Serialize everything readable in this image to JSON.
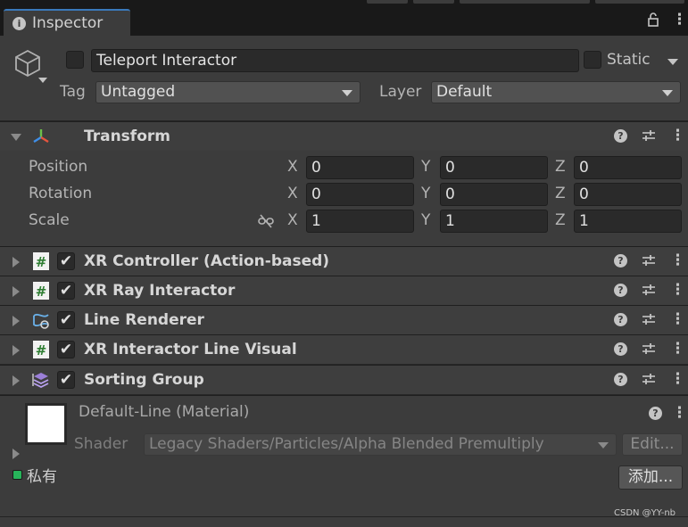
{
  "tab": {
    "label": "Inspector"
  },
  "gameobject": {
    "name": "Teleport Interactor",
    "static_label": "Static",
    "tag_label": "Tag",
    "tag_value": "Untagged",
    "layer_label": "Layer",
    "layer_value": "Default"
  },
  "transform": {
    "title": "Transform",
    "rows": [
      {
        "label": "Position",
        "x": "0",
        "y": "0",
        "z": "0"
      },
      {
        "label": "Rotation",
        "x": "0",
        "y": "0",
        "z": "0"
      },
      {
        "label": "Scale",
        "x": "1",
        "y": "1",
        "z": "1"
      }
    ],
    "axis_x": "X",
    "axis_y": "Y",
    "axis_z": "Z"
  },
  "components": [
    {
      "title": "XR Controller (Action-based)",
      "icon": "script-icon",
      "enabled": true
    },
    {
      "title": "XR Ray Interactor",
      "icon": "script-icon",
      "enabled": true
    },
    {
      "title": "Line Renderer",
      "icon": "line-renderer-icon",
      "enabled": true
    },
    {
      "title": "XR Interactor Line Visual",
      "icon": "script-icon",
      "enabled": true
    },
    {
      "title": "Sorting Group",
      "icon": "sorting-group-icon",
      "enabled": true
    }
  ],
  "material": {
    "name": "Default-Line (Material)",
    "shader_label": "Shader",
    "shader_value": "Legacy Shaders/Particles/Alpha Blended Premultiply",
    "edit_label": "Edit...",
    "private_label": "私有",
    "add_label": "添加..."
  },
  "watermark": "CSDN @YY-nb",
  "colors": {
    "accent": "#3a79bb",
    "panel": "#3c3c3c",
    "field": "#2a2a2a",
    "private_green": "#27b45a"
  }
}
